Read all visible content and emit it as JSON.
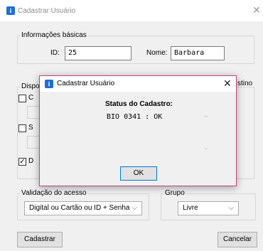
{
  "window": {
    "title": "Cadastrar Usuário",
    "icon": "app-i-icon",
    "close_glyph": "✕"
  },
  "basic_info": {
    "legend": "Informações básicas",
    "id_label": "ID:",
    "id_value": "25",
    "name_label": "Nome:",
    "name_value": "Barbara"
  },
  "devices": {
    "legend_partial": "Dispo",
    "destino_partial": "stino",
    "checkboxes": [
      {
        "checked": false,
        "label_partial": "C"
      },
      {
        "checked": false,
        "label_partial": "S"
      },
      {
        "checked": true,
        "label_partial": "D"
      }
    ],
    "check_glyph": "✓"
  },
  "access": {
    "legend": "Validação do acesso",
    "selected": "Digital ou Cartão ou ID + Senha"
  },
  "group": {
    "legend": "Grupo",
    "selected": "Livre"
  },
  "buttons": {
    "register": "Cadastrar",
    "cancel": "Cancelar"
  },
  "dialog": {
    "title": "Cadastrar Usuário",
    "close_glyph": "✕",
    "status_title": "Status do Cadastro:",
    "status_text": "BIO 0341 : OK",
    "ok_label": "OK",
    "border_color": "#c4457a"
  },
  "glyphs": {
    "chevron_down": "⌵",
    "scroll_up": "^",
    "scroll_down": "⌄"
  }
}
